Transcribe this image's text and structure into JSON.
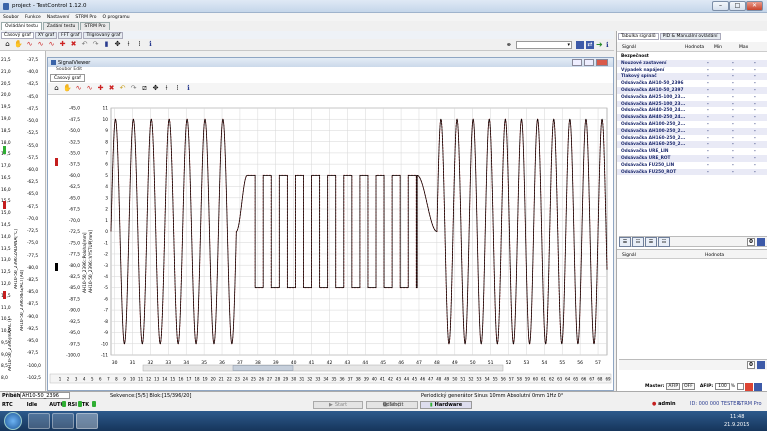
{
  "window": {
    "title": "project - TestControl 1.12.0",
    "minimize": "–",
    "maximize": "□",
    "close": "✕"
  },
  "menu": [
    "Soubor",
    "Funkce",
    "Nastavení",
    "STRM Pro",
    "O programu"
  ],
  "doc_tabs": [
    {
      "label": "Ovládání testu"
    },
    {
      "label": "Zadání testu"
    },
    {
      "label": "STRM Pro"
    }
  ],
  "sub_tabs": [
    {
      "label": "Časový graf"
    },
    {
      "label": "XY graf"
    },
    {
      "label": "FFT graf"
    },
    {
      "label": "Trigrovaný graf"
    }
  ],
  "outer_axis": {
    "left_ticks": [
      "21,5",
      "21,0",
      "20,5",
      "20,0",
      "19,5",
      "19,0",
      "18,5",
      "18,0",
      "17,5",
      "17,0",
      "16,5",
      "16,0",
      "15,5",
      "15,0",
      "14,5",
      "14,0",
      "13,5",
      "13,0",
      "12,5",
      "12,0",
      "11,5",
      "11,0",
      "10,5",
      "10,0",
      "9,5",
      "9,0",
      "8,5",
      "8,0"
    ],
    "right_ticks": [
      "-37,5",
      "-40,0",
      "-42,5",
      "-45,0",
      "-47,5",
      "-50,0",
      "-52,5",
      "-55,0",
      "-57,5",
      "-60,0",
      "-62,5",
      "-65,0",
      "-67,5",
      "-70,0",
      "-72,5",
      "-75,0",
      "-77,5",
      "-80,0",
      "-82,5",
      "-85,0",
      "-87,5",
      "-90,0",
      "-92,5",
      "-95,0",
      "-97,5",
      "-100,0",
      "-102,5"
    ],
    "labels": [
      "AH10-50_2396:ZADANA[°C]",
      "AH10-50_2396:REG/ACT[Ad]",
      "AH10-50_2396[mA/ACT]"
    ]
  },
  "signal_viewer": {
    "title": "SignalViewer",
    "subtitle": "Soubor  Edit",
    "tab": "Časový graf",
    "axis_labels": [
      "AH10-50_2396::VYSTUP[mm]",
      "AH10-50_2396::Poloha[mm]"
    ],
    "chart_data": {
      "type": "line",
      "xlabel": "",
      "ylabel": "",
      "x_ticks": [
        30,
        31,
        32,
        33,
        34,
        35,
        36,
        37,
        38,
        39,
        40,
        41,
        42,
        43,
        44,
        45,
        46,
        47,
        48,
        49,
        50,
        51,
        52,
        53,
        54,
        55,
        56,
        57
      ],
      "y_ticks_left": [
        11,
        10,
        9,
        8,
        7,
        6,
        5,
        4,
        3,
        2,
        1,
        0,
        -1,
        -2,
        -3,
        -4,
        -5,
        -6,
        -7,
        -8,
        -9,
        -10,
        -11
      ],
      "y_ticks_mid": [
        "-45,0",
        "-47,5",
        "-50,0",
        "-52,5",
        "-55,0",
        "-57,5",
        "-60,0",
        "-62,5",
        "-65,0",
        "-67,5",
        "-70,0",
        "-72,5",
        "-75,0",
        "-77,5",
        "-80,0",
        "-82,5",
        "-85,0",
        "-87,5",
        "-90,0",
        "-92,5",
        "-95,0",
        "-97,5",
        "-100,0"
      ],
      "xlim": [
        29.8,
        57.5
      ],
      "ylim": [
        -11,
        11
      ],
      "segments": [
        {
          "kind": "sine",
          "x0": 29.8,
          "x1": 36.8,
          "amplitude": 10,
          "period": 1.0
        },
        {
          "kind": "rise",
          "x0": 36.8,
          "x1": 37.4,
          "y0": 0,
          "y1": 5
        },
        {
          "kind": "square",
          "x0": 37.4,
          "x1": 46.9,
          "high": 5,
          "low": -5,
          "period": 0.9
        },
        {
          "kind": "fall",
          "x0": 46.9,
          "x1": 48.0,
          "y0": 5,
          "y1": 0
        },
        {
          "kind": "sine",
          "x0": 48.0,
          "x1": 57.5,
          "amplitude": 10,
          "period": 0.9
        }
      ],
      "series": [
        {
          "color": "#000000"
        },
        {
          "color": "#c41e1e"
        }
      ],
      "grid": true
    },
    "bottom_ticks": [
      "1",
      "2",
      "3",
      "4",
      "5",
      "6",
      "7",
      "8",
      "9",
      "10",
      "11",
      "12",
      "13",
      "14",
      "15",
      "16",
      "17",
      "18",
      "19",
      "20",
      "21",
      "22",
      "23",
      "24",
      "25",
      "26",
      "27",
      "28",
      "29",
      "30",
      "31",
      "32",
      "33",
      "34",
      "35",
      "36",
      "37",
      "38",
      "39",
      "40",
      "41",
      "42",
      "43",
      "44",
      "45",
      "46",
      "47",
      "48",
      "49",
      "50",
      "51",
      "52",
      "53",
      "54",
      "55",
      "56",
      "57",
      "58",
      "59",
      "60",
      "61",
      "62",
      "63",
      "64",
      "65",
      "66",
      "67",
      "68",
      "69"
    ]
  },
  "right_panel": {
    "tabs": [
      {
        "label": "Tabulka signálů"
      },
      {
        "label": "PID & Manuální ovládání"
      }
    ],
    "headers": {
      "signal": "Signál",
      "value": "Hodnota",
      "min": "Min",
      "max": "Max"
    },
    "rows": [
      {
        "name": "Bezpečnost",
        "value": "",
        "min": "",
        "max": ""
      },
      {
        "name": "Nouzové zastavení",
        "value": "-",
        "min": "-",
        "max": "-"
      },
      {
        "name": "Výpadek napájení",
        "value": "-",
        "min": "-",
        "max": "-"
      },
      {
        "name": "Tlakový spínač",
        "value": "-",
        "min": "-",
        "max": "-"
      },
      {
        "name": "Odsávačka AH10-50_2396",
        "value": "-",
        "min": "-",
        "max": "-"
      },
      {
        "name": "Odsávačka AH10-50_2397",
        "value": "-",
        "min": "-",
        "max": "-"
      },
      {
        "name": "Odsávačka AH25-100_23...",
        "value": "-",
        "min": "-",
        "max": "-"
      },
      {
        "name": "Odsávačka AH25-100_23...",
        "value": "-",
        "min": "-",
        "max": "-"
      },
      {
        "name": "Odsávačka AH40-250_24...",
        "value": "-",
        "min": "-",
        "max": "-"
      },
      {
        "name": "Odsávačka AH40-250_24...",
        "value": "-",
        "min": "-",
        "max": "-"
      },
      {
        "name": "Odsávačka AH100-250_2...",
        "value": "-",
        "min": "-",
        "max": "-"
      },
      {
        "name": "Odsávačka AH100-250_2...",
        "value": "-",
        "min": "-",
        "max": "-"
      },
      {
        "name": "Odsávačka AH160-250_2...",
        "value": "-",
        "min": "-",
        "max": "-"
      },
      {
        "name": "Odsávačka AH160-250_2...",
        "value": "-",
        "min": "-",
        "max": "-"
      },
      {
        "name": "Odsávačka URE_LIN",
        "value": "-",
        "min": "-",
        "max": "-"
      },
      {
        "name": "Odsávačka URE_ROT",
        "value": "-",
        "min": "-",
        "max": "-"
      },
      {
        "name": "Odsávačka FU250_LIN",
        "value": "-",
        "min": "-",
        "max": "-"
      },
      {
        "name": "Odsávačka FU250_ROT",
        "value": "-",
        "min": "-",
        "max": "-"
      }
    ],
    "lower_headers": {
      "signal": "Signál",
      "value": "Hodnota"
    },
    "count1": "0",
    "count2": "0",
    "master_label": "Master:",
    "afp_btn": "AFIP",
    "off_btn": "OFF",
    "afip_label": "AFIP:",
    "afip_value": "100",
    "afip_unit": "%"
  },
  "status": {
    "pribeh_label": "Příběh:",
    "pribeh_value": "AH10-50_2396",
    "sekvence": "Sekvence:[5/5] Blok:[15/396/20]",
    "generator": "Periodický generátor Sinus 10mm Absolutní 0mm 1Hz 0°",
    "indicators": [
      "RTC",
      "Idle",
      "AUTO",
      "RSI",
      "ITK"
    ],
    "buttons": {
      "start": "Start",
      "stop": "Stop",
      "odlehceni": "Odlehčit",
      "hardware": "Hardware"
    },
    "admin": "admin",
    "right_info": "ID: 000 000 TESTER",
    "right_info2": "STRM Pro"
  },
  "taskbar": {
    "time": "11:48",
    "date": "21.9.2015"
  }
}
